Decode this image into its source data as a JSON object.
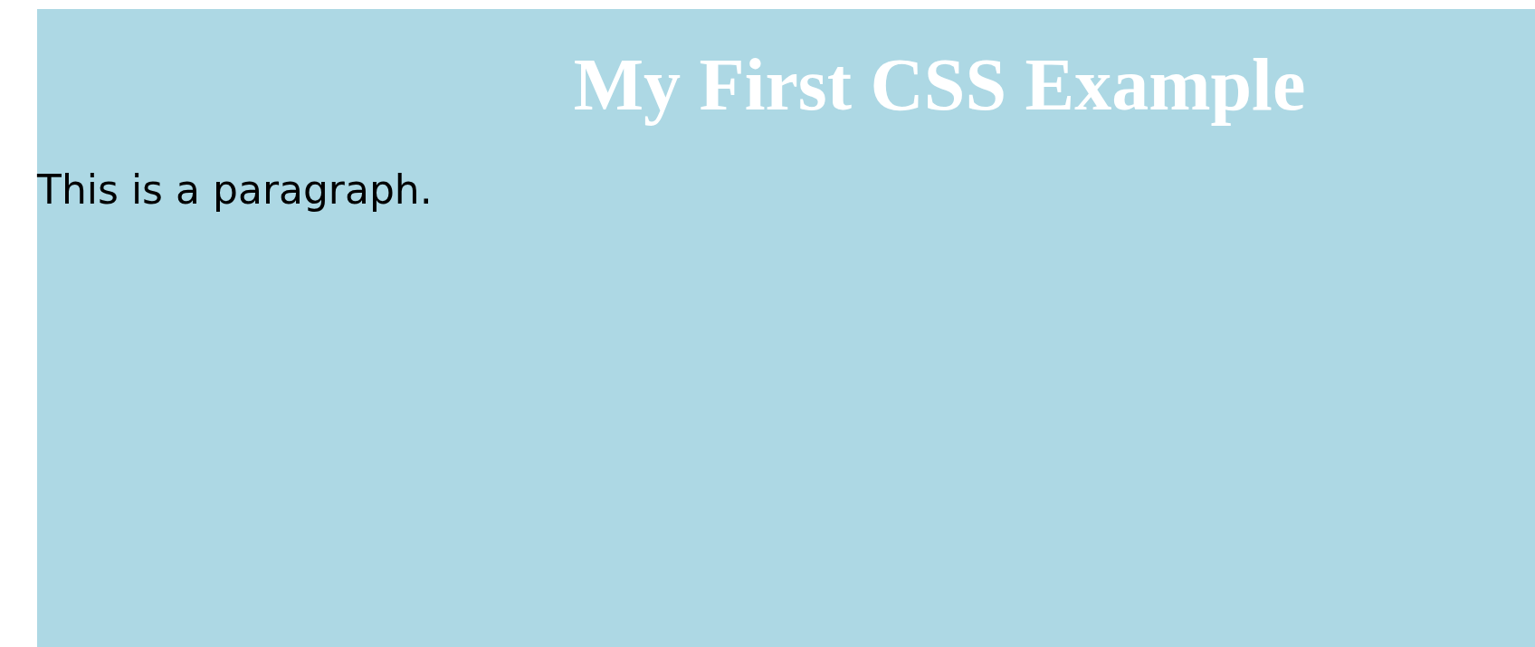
{
  "heading": "My First CSS Example",
  "paragraph": "This is a paragraph."
}
